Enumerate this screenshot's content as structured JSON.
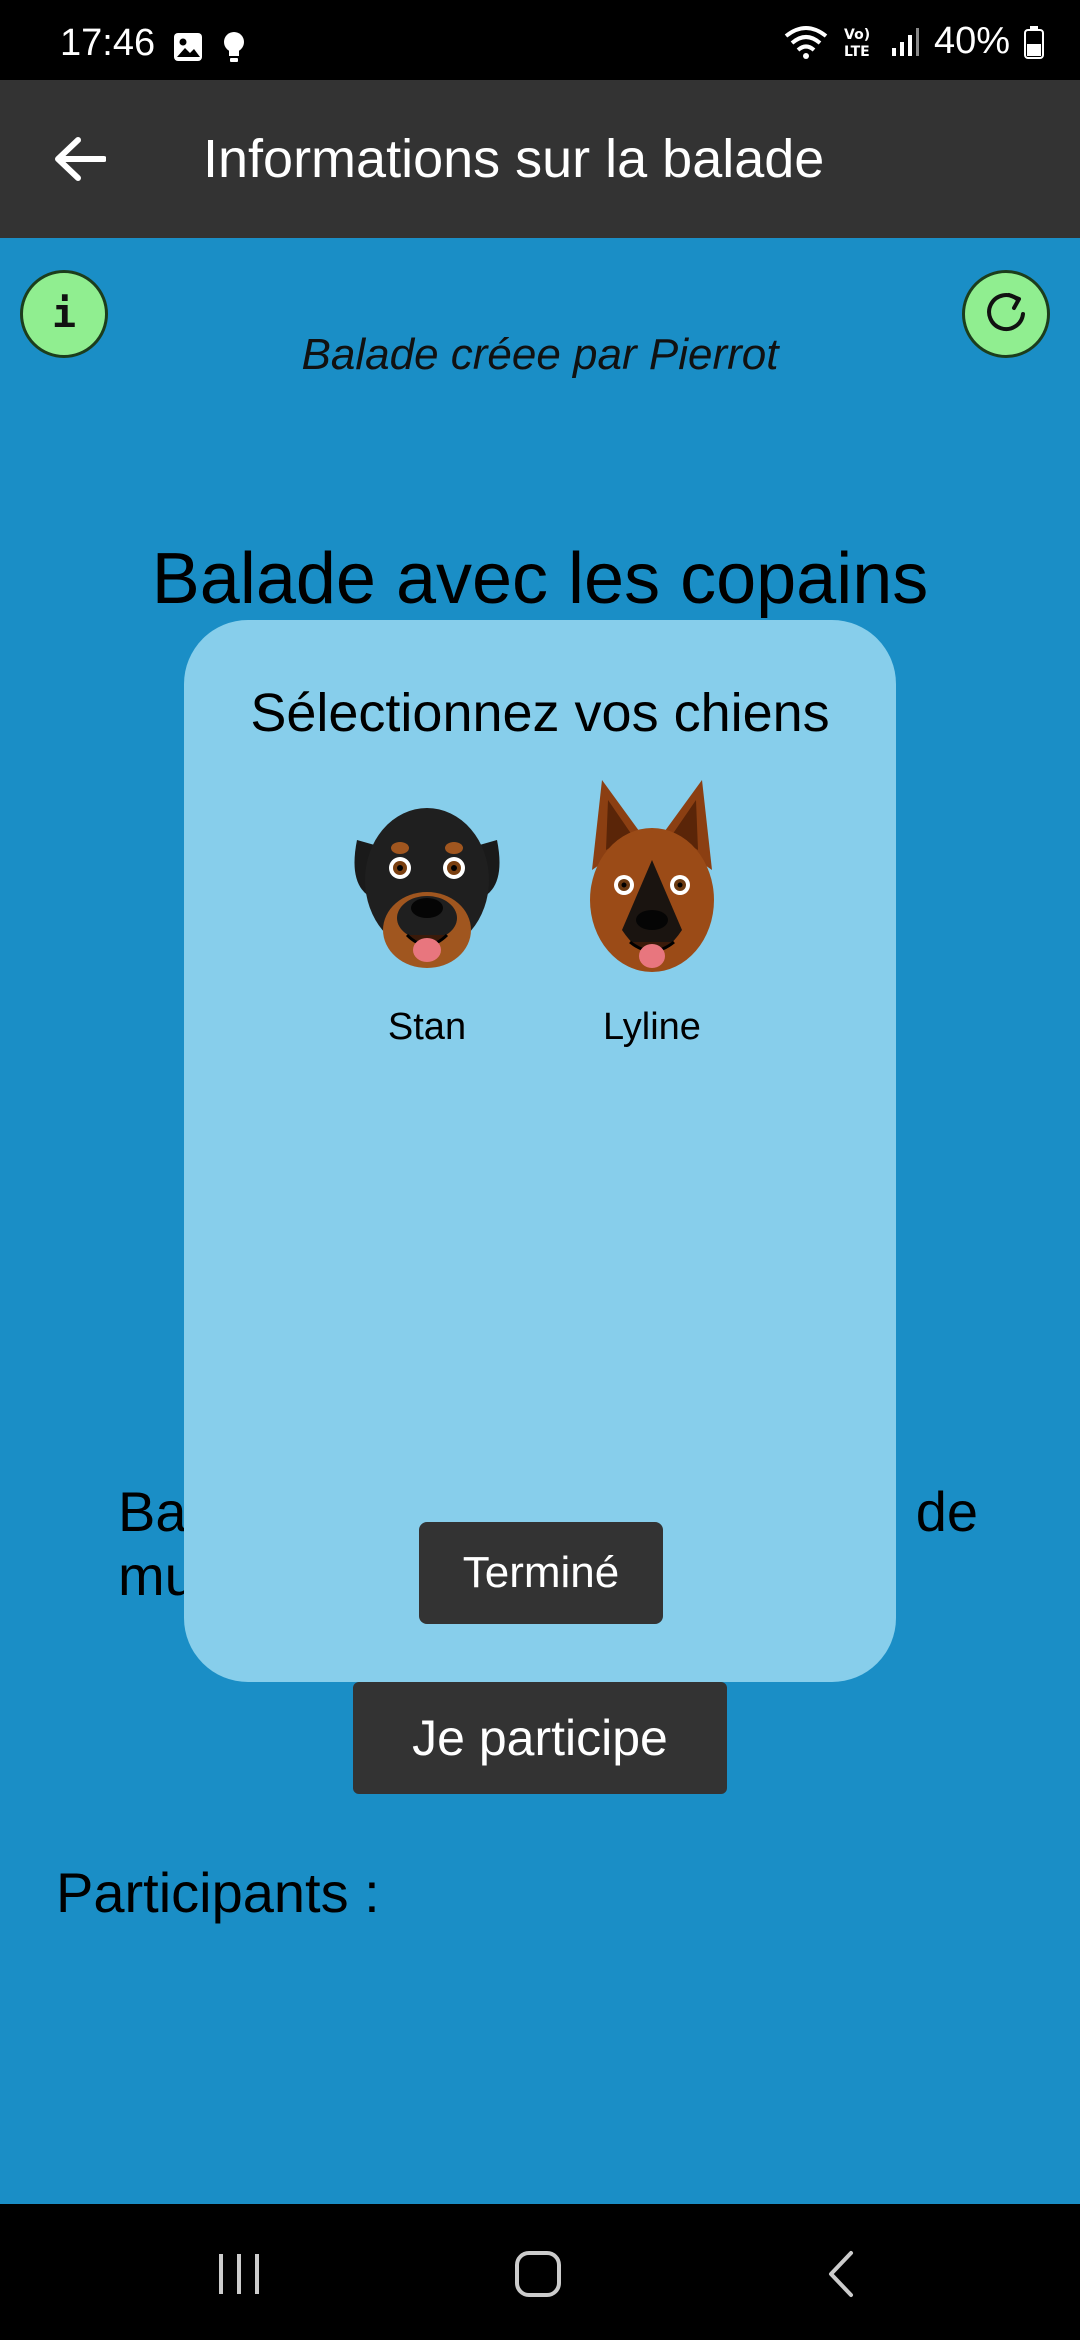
{
  "status_bar": {
    "time": "17:46",
    "battery": "40%",
    "icons": [
      "image-icon",
      "bulb-icon",
      "wifi-icon",
      "volte-icon",
      "signal-icon",
      "battery-icon"
    ]
  },
  "app_bar": {
    "title": "Informations sur la balade",
    "back_icon": "arrow-left-icon"
  },
  "walk": {
    "created_by": "Balade créee par Pierrot",
    "title": "Balade avec les copains",
    "description_fragment_left": "Ba",
    "description_fragment_right": "de",
    "description_fragment_line2": "mu",
    "join_label": "Je participe",
    "participants_label": "Participants :"
  },
  "buttons": {
    "info_letter": "i",
    "info_icon": "info-icon",
    "refresh_icon": "refresh-icon"
  },
  "modal": {
    "title": "Sélectionnez vos chiens",
    "dogs": [
      {
        "name": "Stan",
        "icon": "rottweiler-icon"
      },
      {
        "name": "Lyline",
        "icon": "german-shepherd-icon"
      }
    ],
    "done_label": "Terminé"
  },
  "colors": {
    "background": "#1a8ec6",
    "app_bar": "#333333",
    "modal": "#87ceeb",
    "round_button": "#90ee90",
    "button_dark": "#333333"
  }
}
